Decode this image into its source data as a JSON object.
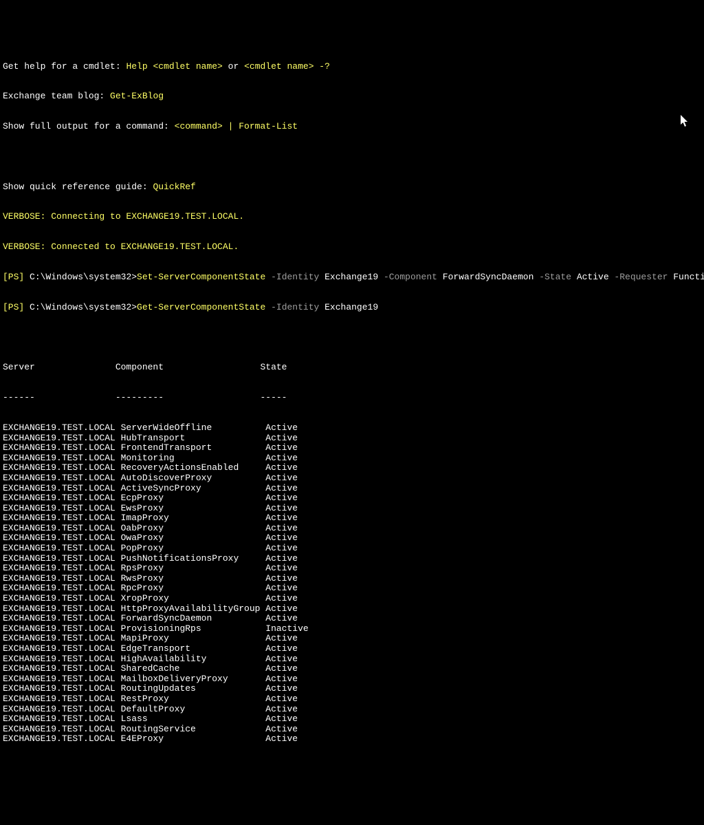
{
  "header": {
    "help_line_1": "Get help for a cmdlet: ",
    "help_cmd_1": "Help <cmdlet name>",
    "help_or": " or ",
    "help_cmd_2": "<cmdlet name> -?",
    "blog_line": "Exchange team blog: ",
    "blog_cmd": "Get-ExBlog",
    "full_output_line": "Show full output for a command: ",
    "full_output_cmd": "<command> | Format-List",
    "quick_ref_line": "Show quick reference guide: ",
    "quick_ref_cmd": "QuickRef",
    "verbose_1": "VERBOSE: Connecting to EXCHANGE19.TEST.LOCAL.",
    "verbose_2": "VERBOSE: Connected to EXCHANGE19.TEST.LOCAL."
  },
  "prompt1": {
    "ps": "[PS] ",
    "path": "C:\\Windows\\system32>",
    "cmd": "Set-ServerComponentState ",
    "p_identity": "-Identity ",
    "v_identity": "Exchange19 ",
    "p_component": "-Component ",
    "v_component": "ForwardSyncDaemon ",
    "p_state": "-State ",
    "v_state": "Active ",
    "p_requester": "-Requester ",
    "v_requester": "Functional"
  },
  "prompt2": {
    "ps": "[PS] ",
    "path": "C:\\Windows\\system32>",
    "cmd": "Get-ServerComponentState ",
    "p_identity": "-Identity ",
    "v_identity": "Exchange19"
  },
  "table": {
    "col1": "Server",
    "col2": "Component",
    "col3": "State",
    "sep1": "------",
    "sep2": "---------",
    "sep3": "-----",
    "col1_width": 21,
    "col2_width": 27,
    "rows": [
      {
        "server": "EXCHANGE19.TEST.LOCAL",
        "component": "ServerWideOffline",
        "state": "Active"
      },
      {
        "server": "EXCHANGE19.TEST.LOCAL",
        "component": "HubTransport",
        "state": "Active"
      },
      {
        "server": "EXCHANGE19.TEST.LOCAL",
        "component": "FrontendTransport",
        "state": "Active"
      },
      {
        "server": "EXCHANGE19.TEST.LOCAL",
        "component": "Monitoring",
        "state": "Active"
      },
      {
        "server": "EXCHANGE19.TEST.LOCAL",
        "component": "RecoveryActionsEnabled",
        "state": "Active"
      },
      {
        "server": "EXCHANGE19.TEST.LOCAL",
        "component": "AutoDiscoverProxy",
        "state": "Active"
      },
      {
        "server": "EXCHANGE19.TEST.LOCAL",
        "component": "ActiveSyncProxy",
        "state": "Active"
      },
      {
        "server": "EXCHANGE19.TEST.LOCAL",
        "component": "EcpProxy",
        "state": "Active"
      },
      {
        "server": "EXCHANGE19.TEST.LOCAL",
        "component": "EwsProxy",
        "state": "Active"
      },
      {
        "server": "EXCHANGE19.TEST.LOCAL",
        "component": "ImapProxy",
        "state": "Active"
      },
      {
        "server": "EXCHANGE19.TEST.LOCAL",
        "component": "OabProxy",
        "state": "Active"
      },
      {
        "server": "EXCHANGE19.TEST.LOCAL",
        "component": "OwaProxy",
        "state": "Active"
      },
      {
        "server": "EXCHANGE19.TEST.LOCAL",
        "component": "PopProxy",
        "state": "Active"
      },
      {
        "server": "EXCHANGE19.TEST.LOCAL",
        "component": "PushNotificationsProxy",
        "state": "Active"
      },
      {
        "server": "EXCHANGE19.TEST.LOCAL",
        "component": "RpsProxy",
        "state": "Active"
      },
      {
        "server": "EXCHANGE19.TEST.LOCAL",
        "component": "RwsProxy",
        "state": "Active"
      },
      {
        "server": "EXCHANGE19.TEST.LOCAL",
        "component": "RpcProxy",
        "state": "Active"
      },
      {
        "server": "EXCHANGE19.TEST.LOCAL",
        "component": "XropProxy",
        "state": "Active"
      },
      {
        "server": "EXCHANGE19.TEST.LOCAL",
        "component": "HttpProxyAvailabilityGroup",
        "state": "Active"
      },
      {
        "server": "EXCHANGE19.TEST.LOCAL",
        "component": "ForwardSyncDaemon",
        "state": "Active"
      },
      {
        "server": "EXCHANGE19.TEST.LOCAL",
        "component": "ProvisioningRps",
        "state": "Inactive"
      },
      {
        "server": "EXCHANGE19.TEST.LOCAL",
        "component": "MapiProxy",
        "state": "Active"
      },
      {
        "server": "EXCHANGE19.TEST.LOCAL",
        "component": "EdgeTransport",
        "state": "Active"
      },
      {
        "server": "EXCHANGE19.TEST.LOCAL",
        "component": "HighAvailability",
        "state": "Active"
      },
      {
        "server": "EXCHANGE19.TEST.LOCAL",
        "component": "SharedCache",
        "state": "Active"
      },
      {
        "server": "EXCHANGE19.TEST.LOCAL",
        "component": "MailboxDeliveryProxy",
        "state": "Active"
      },
      {
        "server": "EXCHANGE19.TEST.LOCAL",
        "component": "RoutingUpdates",
        "state": "Active"
      },
      {
        "server": "EXCHANGE19.TEST.LOCAL",
        "component": "RestProxy",
        "state": "Active"
      },
      {
        "server": "EXCHANGE19.TEST.LOCAL",
        "component": "DefaultProxy",
        "state": "Active"
      },
      {
        "server": "EXCHANGE19.TEST.LOCAL",
        "component": "Lsass",
        "state": "Active"
      },
      {
        "server": "EXCHANGE19.TEST.LOCAL",
        "component": "RoutingService",
        "state": "Active"
      },
      {
        "server": "EXCHANGE19.TEST.LOCAL",
        "component": "E4EProxy",
        "state": "Active"
      }
    ]
  }
}
